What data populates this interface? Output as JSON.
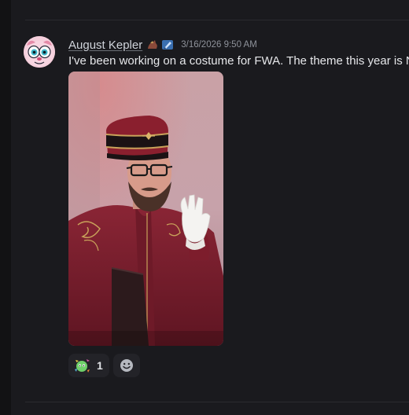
{
  "message": {
    "author": "August Kepler",
    "timestamp": "3/16/2026 9:50 AM",
    "text": "I've been working on a costume for FWA. The theme this year is N",
    "avatar_icon": "pink-creature-avatar",
    "role_icons": [
      "horse-badge-icon",
      "paint-brush-badge-icon"
    ],
    "attachment": {
      "type": "image",
      "subject": "man in burgundy bellhop costume with red cap, glasses and white glove waving"
    },
    "reactions": [
      {
        "emoji": "sparkle-creature-emoji-icon",
        "count": "1"
      }
    ],
    "add_reaction_icon": "smiley-add-reaction-icon"
  },
  "colors": {
    "background": "#1a1a1e",
    "username": "#cfd3da",
    "text": "#e6e7ea",
    "timestamp": "#8e929a",
    "reaction_bg": "#232328",
    "costume": "#7a1f2e"
  }
}
